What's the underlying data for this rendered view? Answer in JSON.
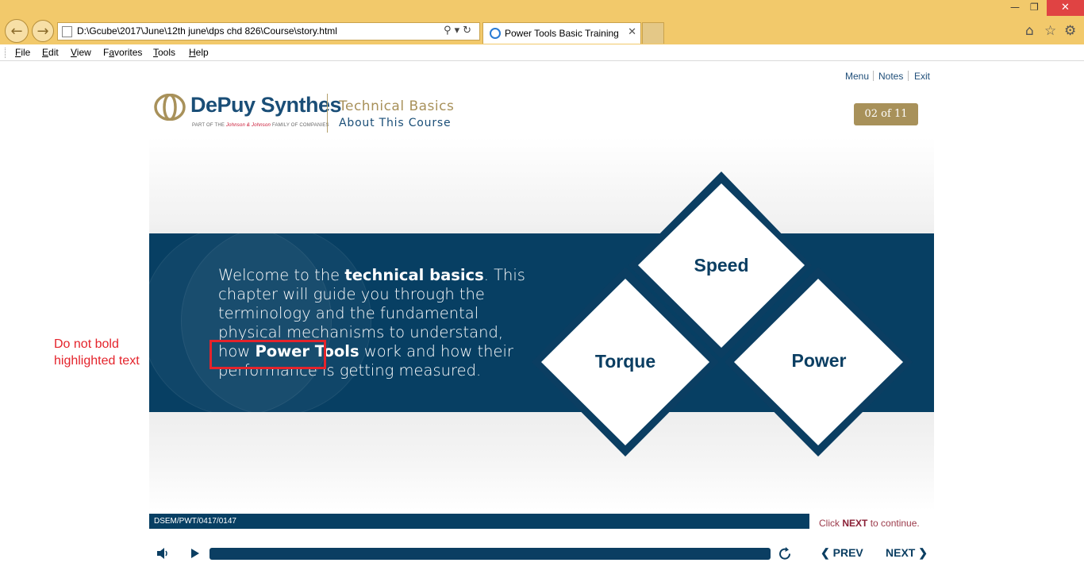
{
  "browser": {
    "address": "D:\\Gcube\\2017\\June\\12th june\\dps chd 826\\Course\\story.html",
    "tab_title": "Power Tools Basic Training",
    "menu": [
      "File",
      "Edit",
      "View",
      "Favorites",
      "Tools",
      "Help"
    ],
    "menu_underline": [
      "F",
      "E",
      "V",
      "a",
      "T",
      "H"
    ]
  },
  "course": {
    "top_links": [
      "Menu",
      "Notes",
      "Exit"
    ],
    "brand": "DePuy Synthes",
    "brand_sub_pre": "PART OF THE ",
    "brand_sub_jj": "Johnson & Johnson",
    "brand_sub_post": " FAMILY OF COMPANIES",
    "title": "Technical Basics",
    "subtitle": "About This Course",
    "pager": "02 of 11"
  },
  "slide": {
    "intro_1": "Welcome to the ",
    "intro_bold_1": "technical basics",
    "intro_2": ". This chapter will guide you through the terminology and the fundamental physical mechanisms to understand, how ",
    "intro_bold_2": "Power Tools",
    "intro_3": " work and how their performance is getting measured.",
    "diamonds": [
      "Speed",
      "Torque",
      "Power"
    ]
  },
  "annotation": {
    "note_line1": "Do not bold",
    "note_line2": "highlighted text",
    "color": "#e4232b"
  },
  "footer": {
    "code": "DSEM/PWT/0417/0147",
    "continue_pre": "Click ",
    "continue_bold": "NEXT",
    "continue_post": " to continue.",
    "prev": "PREV",
    "next": "NEXT"
  },
  "colors": {
    "navy": "#073f63",
    "gold": "#a8915a",
    "chrome": "#f2c96b"
  }
}
